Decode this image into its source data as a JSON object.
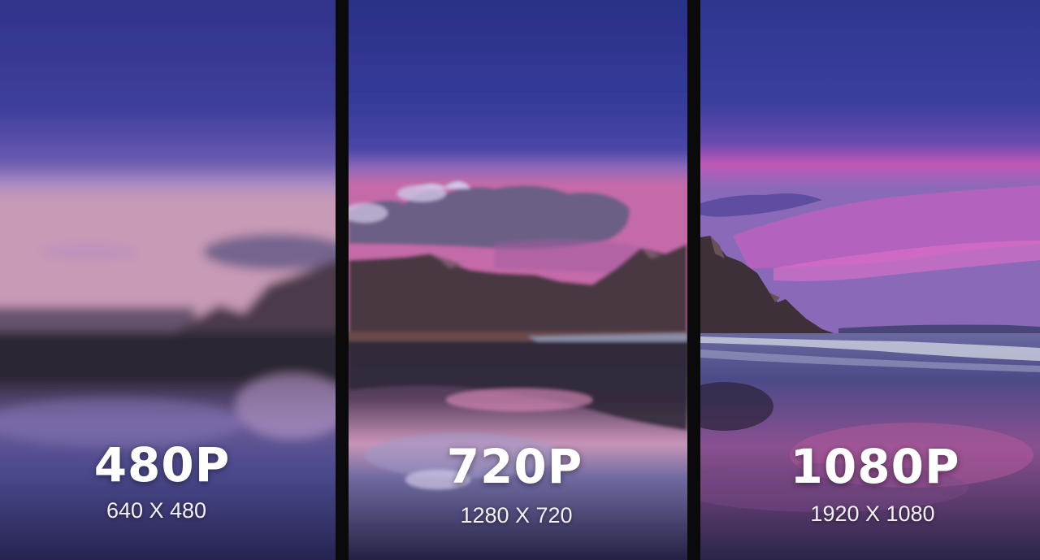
{
  "panels": [
    {
      "id": "480p",
      "title": "480P",
      "dimensions": "640 X 480"
    },
    {
      "id": "720p",
      "title": "720P",
      "dimensions": "1280 X 720"
    },
    {
      "id": "1080p",
      "title": "1080P",
      "dimensions": "1920 X 1080"
    }
  ],
  "colors": {
    "sky_top": "#2f3590",
    "sky_mid": "#4a3ea0",
    "sunset_pink": "#d86ab8",
    "mountain": "#4a3a45",
    "water_dark": "#1e1c3a",
    "divider": "#0a0a0a",
    "text": "#ffffff"
  }
}
